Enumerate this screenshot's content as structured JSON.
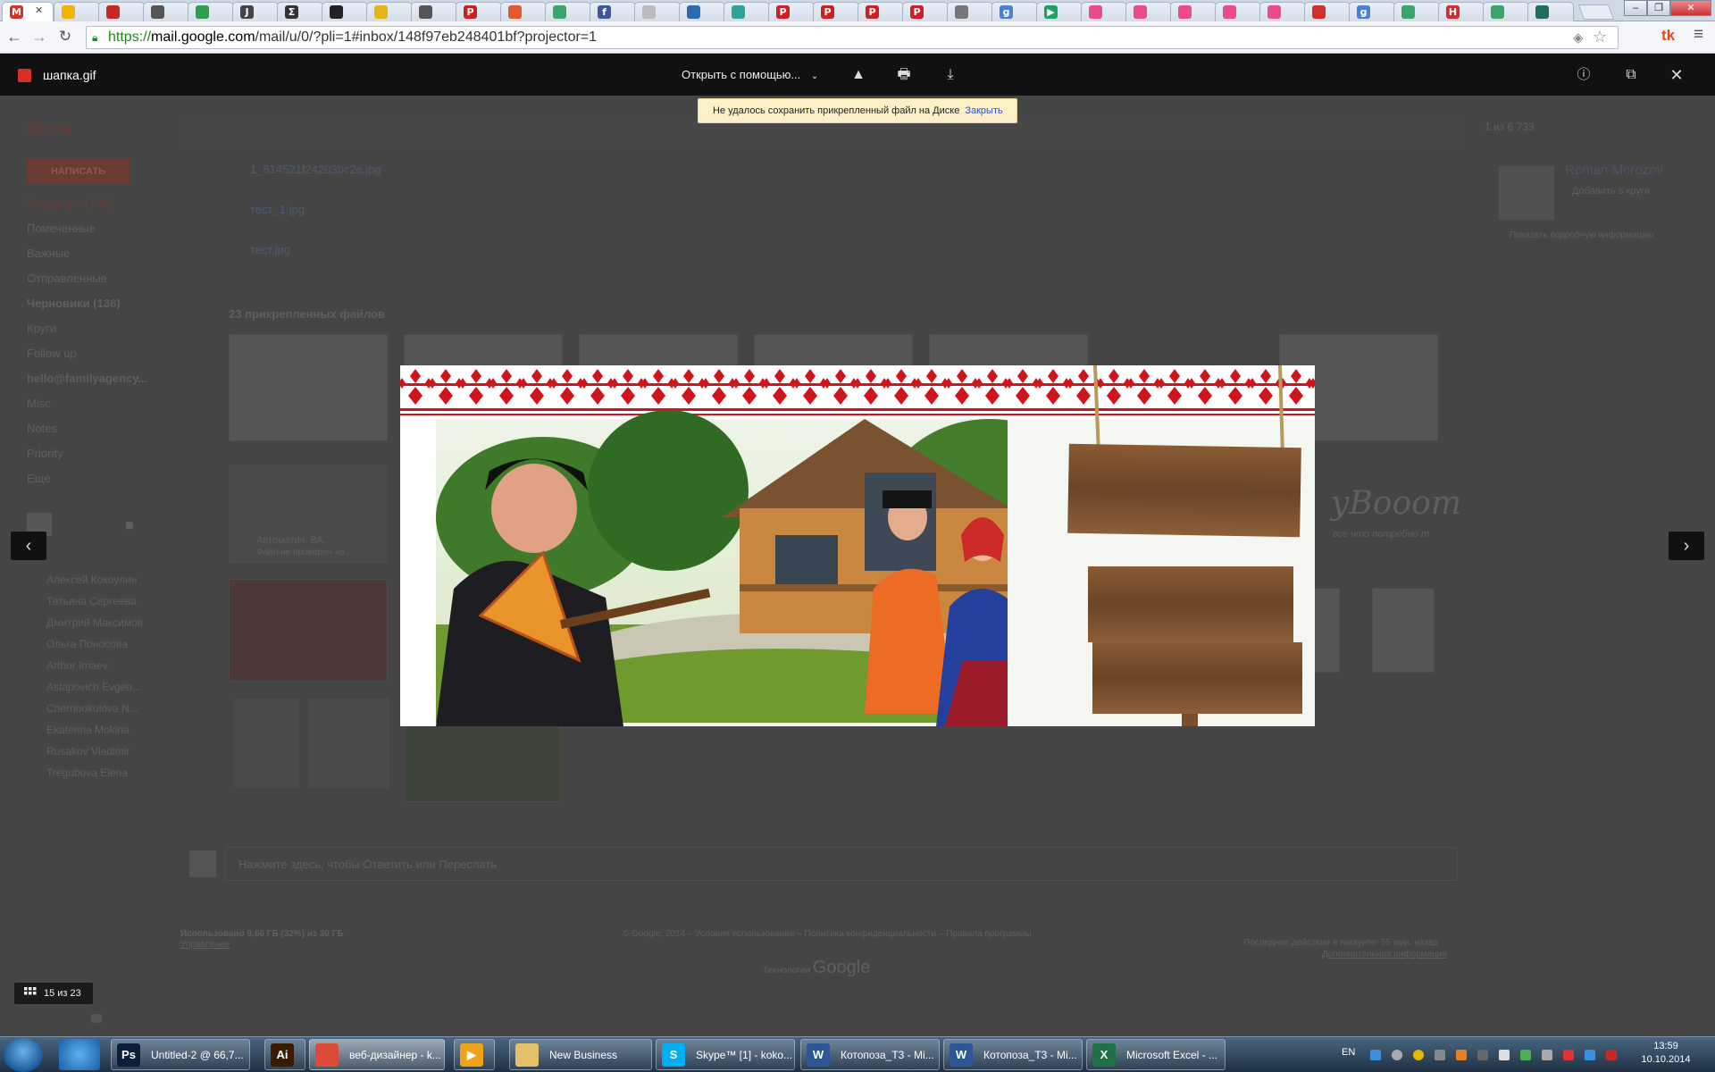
{
  "browser": {
    "url_scheme": "https://",
    "url_host": "mail.google.com",
    "url_path": "/mail/u/0/?pli=1#inbox/148f97eb248401bf?projector=1",
    "tabs": [
      {
        "icon": "gmail-icon",
        "color": "#d93025",
        "letter": "M"
      },
      {
        "icon": "drive-icon",
        "color": "#f2b400",
        "letter": ""
      },
      {
        "icon": "app-icon",
        "color": "#c62828",
        "letter": ""
      },
      {
        "icon": "document-icon",
        "color": "#555",
        "letter": ""
      },
      {
        "icon": "translate-icon",
        "color": "#2e9e4f",
        "letter": ""
      },
      {
        "icon": "j-icon",
        "color": "#444",
        "letter": "J"
      },
      {
        "icon": "sum-icon",
        "color": "#333",
        "letter": "Σ"
      },
      {
        "icon": "square-icon",
        "color": "#222",
        "letter": ""
      },
      {
        "icon": "folder-icon",
        "color": "#e8b21a",
        "letter": ""
      },
      {
        "icon": "pin-icon",
        "color": "#555",
        "letter": ""
      },
      {
        "icon": "pinterest-icon",
        "color": "#cb2027",
        "letter": "P"
      },
      {
        "icon": "gear-icon",
        "color": "#e05a2b",
        "letter": ""
      },
      {
        "icon": "cloud-icon",
        "color": "#3aa56b",
        "letter": ""
      },
      {
        "icon": "facebook-icon",
        "color": "#3b5998",
        "letter": "f"
      },
      {
        "icon": "page-icon",
        "color": "#bbb",
        "letter": ""
      },
      {
        "icon": "layers-icon",
        "color": "#2b6cb0",
        "letter": ""
      },
      {
        "icon": "leaf-icon",
        "color": "#2fa39b",
        "letter": ""
      },
      {
        "icon": "pinterest-icon",
        "color": "#cb2027",
        "letter": "P"
      },
      {
        "icon": "pinterest-icon",
        "color": "#cb2027",
        "letter": "P"
      },
      {
        "icon": "pinterest-icon",
        "color": "#cb2027",
        "letter": "P"
      },
      {
        "icon": "pinterest-icon",
        "color": "#cb2027",
        "letter": "P"
      },
      {
        "icon": "hand-icon",
        "color": "#777",
        "letter": ""
      },
      {
        "icon": "google-icon",
        "color": "#4a7fd6",
        "letter": "g"
      },
      {
        "icon": "play-icon",
        "color": "#1aa260",
        "letter": "▶"
      },
      {
        "icon": "dribbble-icon",
        "color": "#ea4c89",
        "letter": ""
      },
      {
        "icon": "dribbble-icon",
        "color": "#ea4c89",
        "letter": ""
      },
      {
        "icon": "dribbble-icon",
        "color": "#ea4c89",
        "letter": ""
      },
      {
        "icon": "dribbble-icon",
        "color": "#ea4c89",
        "letter": ""
      },
      {
        "icon": "dribbble-icon",
        "color": "#ea4c89",
        "letter": ""
      },
      {
        "icon": "bug-icon",
        "color": "#d32f2f",
        "letter": ""
      },
      {
        "icon": "google-icon",
        "color": "#4a7fd6",
        "letter": "g"
      },
      {
        "icon": "cloud-icon",
        "color": "#3aa56b",
        "letter": ""
      },
      {
        "icon": "hh-icon",
        "color": "#d32f2f",
        "letter": "H"
      },
      {
        "icon": "cloud-icon",
        "color": "#3aa56b",
        "letter": ""
      },
      {
        "icon": "wave-icon",
        "color": "#1f6e5c",
        "letter": ""
      }
    ]
  },
  "viewer": {
    "filename": "шапка.gif",
    "open_with": "Открыть с помощью...",
    "notice_text": "Не удалось сохранить прикрепленный файл на Диске",
    "notice_link": "Закрыть",
    "counter": "15 из 23"
  },
  "gmail_bg": {
    "mail_label": "Почта",
    "compose": "НАПИСАТЬ",
    "folders": [
      "Входящие (108)",
      "Помеченные",
      "Важные",
      "Отправленные",
      "Черновики (136)",
      "Круги",
      "Follow up",
      "hello@familyagency...",
      "Misc",
      "Notes",
      "Priority",
      "Еще"
    ],
    "contacts": [
      "Алексей Кокоулин",
      "Татьяна Сергеева",
      "Дмитрий Максимов",
      "Ольга Поносова",
      "Arthur Imaev",
      "Astapovich Evgen...",
      "Chernookulova N...",
      "Ekaterina Mokina",
      "Rusakov Vladimir",
      "Tregubova Elena"
    ],
    "attachments": [
      "1_814521f24203bc2e.jpg",
      "тест_1.jpg",
      "тест.jpg"
    ],
    "attachments_count": "23 прикрепленных файлов",
    "pager": "1 из 6 739",
    "contact_name": "Roman Morozov",
    "contact_add": "Добавить в круги",
    "contact_more": "Показать подробную информацию",
    "reply_hint": "Нажмите здесь, чтобы Ответить или Переслать",
    "storage": "Использовано 9,66 ГБ (32%) из 30 ГБ",
    "storage_link": "Управление",
    "footer": "© Google, 2014 – Условия использования – Политика конфиденциальности – Правила программы",
    "tech": "Технологии",
    "tech_brand": "Google",
    "last_activity": "Последние действия в аккаунте: 55 мин. назад",
    "last_activity_link": "Дополнительная информация",
    "doc_title": "Автоматич. ВА..",
    "doc_sub": "Файл не проверен на..",
    "brand_text": "yBooom",
    "brand_sub": "все что потребно т"
  },
  "taskbar": {
    "items": [
      {
        "label": "Untitled-2 @ 66,7...",
        "icon": "photoshop-icon",
        "letter": "Ps",
        "color": "#0b1f3a"
      },
      {
        "label": "",
        "icon": "illustrator-icon",
        "letter": "Ai",
        "color": "#3a1a00"
      },
      {
        "label": "веб-дизайнер - k...",
        "icon": "chrome-icon",
        "letter": "",
        "color": "#dd4b39"
      },
      {
        "label": "",
        "icon": "media-player-icon",
        "letter": "▶",
        "color": "#f0a21a"
      },
      {
        "label": "New Business",
        "icon": "folder-icon",
        "letter": "",
        "color": "#e3c06a"
      },
      {
        "label": "Skype™ [1] - koko...",
        "icon": "skype-icon",
        "letter": "S",
        "color": "#00aff0"
      },
      {
        "label": "Котопоза_Т3 - Mi...",
        "icon": "word-icon",
        "letter": "W",
        "color": "#2b579a"
      },
      {
        "label": "Котопоза_Т3 - Mi...",
        "icon": "word-icon",
        "letter": "W",
        "color": "#2b579a"
      },
      {
        "label": "Microsoft Excel - ...",
        "icon": "excel-icon",
        "letter": "X",
        "color": "#1e7145"
      }
    ],
    "lang": "EN",
    "time": "13:59",
    "date": "10.10.2014"
  }
}
